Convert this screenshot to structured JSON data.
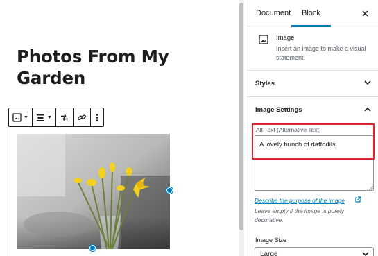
{
  "editor": {
    "post_title": "Photos From My Garden",
    "toolbar": {
      "buttons": [
        {
          "name": "change-block-type-button",
          "icon": "image-icon"
        },
        {
          "name": "change-alignment-button",
          "icon": "align-center-icon"
        },
        {
          "name": "replace-image-button",
          "icon": "replace-icon"
        },
        {
          "name": "insert-link-button",
          "icon": "link-icon"
        },
        {
          "name": "more-options-button",
          "icon": "vertical-ellipsis-icon"
        }
      ]
    },
    "image": {
      "subject": "daffodils",
      "handle_color": "#007cba"
    }
  },
  "sidebar": {
    "tabs": [
      {
        "label": "Document",
        "active": false
      },
      {
        "label": "Block",
        "active": true
      }
    ],
    "close_icon": "close-icon",
    "block_card": {
      "title": "Image",
      "description": "Insert an image to make a visual statement.",
      "icon": "image-icon"
    },
    "panels": {
      "styles": {
        "title": "Styles",
        "expanded": false
      },
      "image_settings": {
        "title": "Image Settings",
        "expanded": true
      }
    },
    "alt_text": {
      "label": "Alt Text (Alternative Text)",
      "value": "A lovely bunch of daffodils",
      "link": "Describe the purpose of the image",
      "help": "Leave empty if the image is purely decorative."
    },
    "image_size": {
      "label": "Image Size",
      "value": "Large"
    }
  },
  "colors": {
    "accent": "#007cba",
    "highlight": "#e0242b",
    "text": "#1e1e1e",
    "muted": "#555d66"
  }
}
